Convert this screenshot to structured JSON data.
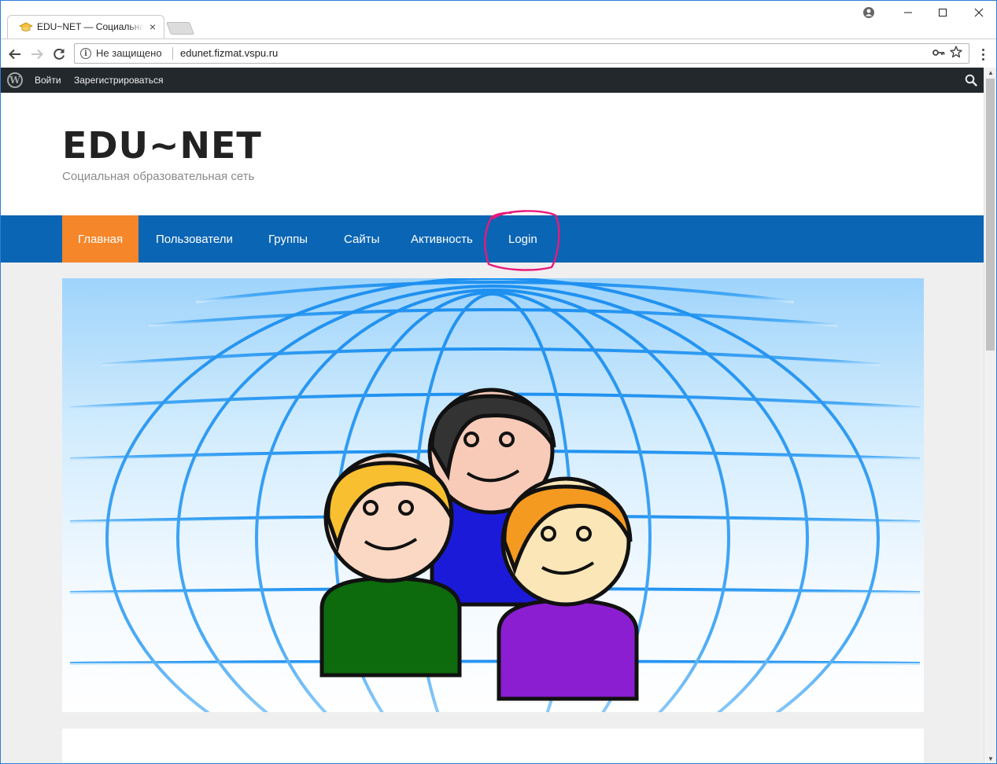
{
  "browser": {
    "tab_title": "EDU~NET — Социальная образовательная сеть",
    "tab_close": "×",
    "security_label": "Не защищено",
    "url": "edunet.fizmat.vspu.ru"
  },
  "adminbar": {
    "login": "Войти",
    "register": "Зарегистрироваться"
  },
  "site": {
    "title": "EDU~NET",
    "description": "Социальная образовательная сеть"
  },
  "nav": {
    "items": [
      {
        "label": "Главная"
      },
      {
        "label": "Пользователи"
      },
      {
        "label": "Группы"
      },
      {
        "label": "Сайты"
      },
      {
        "label": "Активность"
      },
      {
        "label": "Login"
      }
    ]
  },
  "colors": {
    "adminbar_bg": "#23282d",
    "nav_bg": "#0a66b5",
    "nav_active": "#f5862a",
    "annotation": "#e8197a",
    "page_bg": "#efefef"
  }
}
